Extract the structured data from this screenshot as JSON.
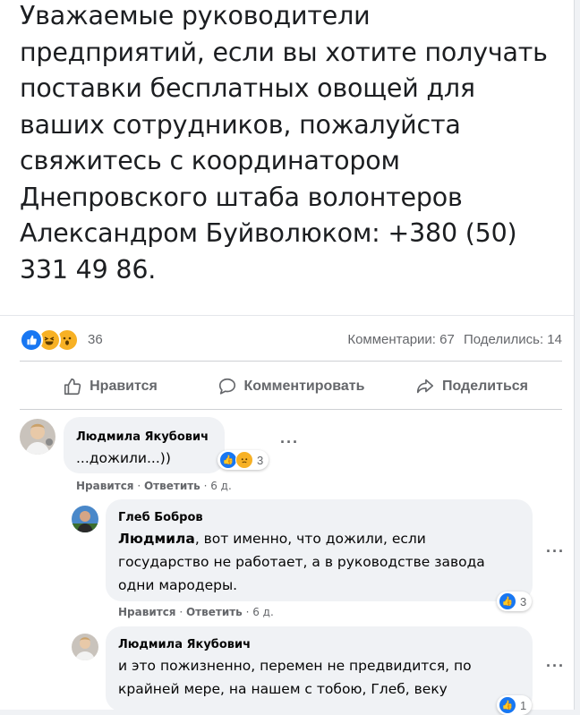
{
  "post": {
    "lines": [
      "Уважаемые руководители",
      "предприятий, если вы хотите получать",
      "поставки бесплатных овощей для",
      "ваших сотрудников, пожалуйста",
      "свяжитесь с координатором",
      "Днепровского штаба волонтеров",
      "Александром Буйволюком: +380 (50)",
      "331 49 86."
    ]
  },
  "stats": {
    "reaction_count": "36",
    "comments": "Комментарии: 67",
    "shares": "Поделились: 14",
    "reaction_icons": [
      "like-icon",
      "haha-icon",
      "wow-icon"
    ]
  },
  "actions": {
    "like": "Нравится",
    "comment": "Комментировать",
    "share": "Поделиться"
  },
  "comments": [
    {
      "name": "Людмила Якубович",
      "text": "...дожили...))",
      "reactions": "3",
      "like_label": "Нравится",
      "reply_label": "Ответить",
      "time": "6 д."
    },
    {
      "name": "Глеб Бобров",
      "mention": "Людмила",
      "text_line1": ", вот именно, что дожили, если",
      "text_line2": "государство не работает, а в руководстве завода",
      "text_line3": "одни мародеры.",
      "reactions": "3",
      "like_label": "Нравится",
      "reply_label": "Ответить",
      "time": "6 д."
    },
    {
      "name": "Людмила Якубович",
      "text_line1": "и это пожизненно, перемен не предвидится, по",
      "text_line2": "крайней мере, на нашем с тобою, Глеб, веку",
      "reactions": "1"
    }
  ],
  "colors": {
    "like_blue": "#1877f2",
    "emoji_yellow": "#f7b125",
    "meta_gray": "#65676b",
    "bubble_bg": "#f0f2f5"
  }
}
